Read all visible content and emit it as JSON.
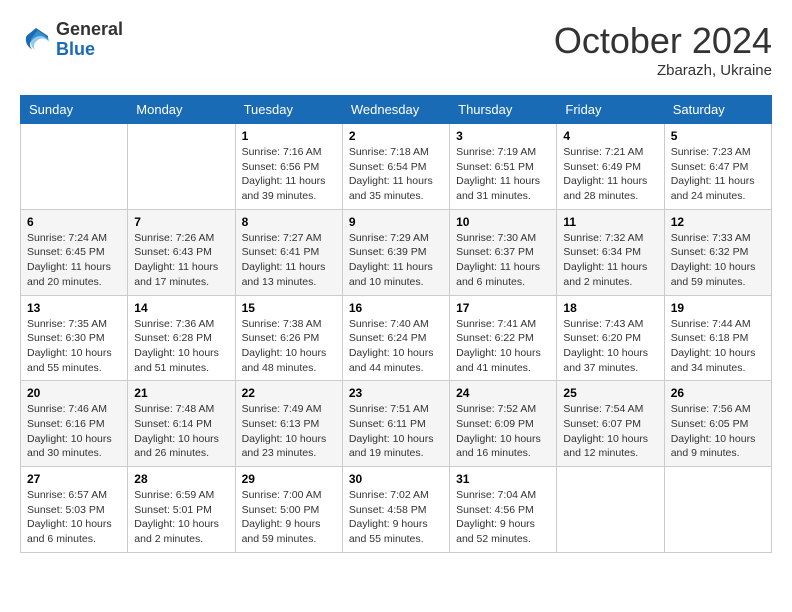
{
  "logo": {
    "general": "General",
    "blue": "Blue"
  },
  "header": {
    "month": "October 2024",
    "location": "Zbarazh, Ukraine"
  },
  "days_of_week": [
    "Sunday",
    "Monday",
    "Tuesday",
    "Wednesday",
    "Thursday",
    "Friday",
    "Saturday"
  ],
  "weeks": [
    [
      {
        "day": null,
        "sunrise": null,
        "sunset": null,
        "daylight": null
      },
      {
        "day": null,
        "sunrise": null,
        "sunset": null,
        "daylight": null
      },
      {
        "day": "1",
        "sunrise": "Sunrise: 7:16 AM",
        "sunset": "Sunset: 6:56 PM",
        "daylight": "Daylight: 11 hours and 39 minutes."
      },
      {
        "day": "2",
        "sunrise": "Sunrise: 7:18 AM",
        "sunset": "Sunset: 6:54 PM",
        "daylight": "Daylight: 11 hours and 35 minutes."
      },
      {
        "day": "3",
        "sunrise": "Sunrise: 7:19 AM",
        "sunset": "Sunset: 6:51 PM",
        "daylight": "Daylight: 11 hours and 31 minutes."
      },
      {
        "day": "4",
        "sunrise": "Sunrise: 7:21 AM",
        "sunset": "Sunset: 6:49 PM",
        "daylight": "Daylight: 11 hours and 28 minutes."
      },
      {
        "day": "5",
        "sunrise": "Sunrise: 7:23 AM",
        "sunset": "Sunset: 6:47 PM",
        "daylight": "Daylight: 11 hours and 24 minutes."
      }
    ],
    [
      {
        "day": "6",
        "sunrise": "Sunrise: 7:24 AM",
        "sunset": "Sunset: 6:45 PM",
        "daylight": "Daylight: 11 hours and 20 minutes."
      },
      {
        "day": "7",
        "sunrise": "Sunrise: 7:26 AM",
        "sunset": "Sunset: 6:43 PM",
        "daylight": "Daylight: 11 hours and 17 minutes."
      },
      {
        "day": "8",
        "sunrise": "Sunrise: 7:27 AM",
        "sunset": "Sunset: 6:41 PM",
        "daylight": "Daylight: 11 hours and 13 minutes."
      },
      {
        "day": "9",
        "sunrise": "Sunrise: 7:29 AM",
        "sunset": "Sunset: 6:39 PM",
        "daylight": "Daylight: 11 hours and 10 minutes."
      },
      {
        "day": "10",
        "sunrise": "Sunrise: 7:30 AM",
        "sunset": "Sunset: 6:37 PM",
        "daylight": "Daylight: 11 hours and 6 minutes."
      },
      {
        "day": "11",
        "sunrise": "Sunrise: 7:32 AM",
        "sunset": "Sunset: 6:34 PM",
        "daylight": "Daylight: 11 hours and 2 minutes."
      },
      {
        "day": "12",
        "sunrise": "Sunrise: 7:33 AM",
        "sunset": "Sunset: 6:32 PM",
        "daylight": "Daylight: 10 hours and 59 minutes."
      }
    ],
    [
      {
        "day": "13",
        "sunrise": "Sunrise: 7:35 AM",
        "sunset": "Sunset: 6:30 PM",
        "daylight": "Daylight: 10 hours and 55 minutes."
      },
      {
        "day": "14",
        "sunrise": "Sunrise: 7:36 AM",
        "sunset": "Sunset: 6:28 PM",
        "daylight": "Daylight: 10 hours and 51 minutes."
      },
      {
        "day": "15",
        "sunrise": "Sunrise: 7:38 AM",
        "sunset": "Sunset: 6:26 PM",
        "daylight": "Daylight: 10 hours and 48 minutes."
      },
      {
        "day": "16",
        "sunrise": "Sunrise: 7:40 AM",
        "sunset": "Sunset: 6:24 PM",
        "daylight": "Daylight: 10 hours and 44 minutes."
      },
      {
        "day": "17",
        "sunrise": "Sunrise: 7:41 AM",
        "sunset": "Sunset: 6:22 PM",
        "daylight": "Daylight: 10 hours and 41 minutes."
      },
      {
        "day": "18",
        "sunrise": "Sunrise: 7:43 AM",
        "sunset": "Sunset: 6:20 PM",
        "daylight": "Daylight: 10 hours and 37 minutes."
      },
      {
        "day": "19",
        "sunrise": "Sunrise: 7:44 AM",
        "sunset": "Sunset: 6:18 PM",
        "daylight": "Daylight: 10 hours and 34 minutes."
      }
    ],
    [
      {
        "day": "20",
        "sunrise": "Sunrise: 7:46 AM",
        "sunset": "Sunset: 6:16 PM",
        "daylight": "Daylight: 10 hours and 30 minutes."
      },
      {
        "day": "21",
        "sunrise": "Sunrise: 7:48 AM",
        "sunset": "Sunset: 6:14 PM",
        "daylight": "Daylight: 10 hours and 26 minutes."
      },
      {
        "day": "22",
        "sunrise": "Sunrise: 7:49 AM",
        "sunset": "Sunset: 6:13 PM",
        "daylight": "Daylight: 10 hours and 23 minutes."
      },
      {
        "day": "23",
        "sunrise": "Sunrise: 7:51 AM",
        "sunset": "Sunset: 6:11 PM",
        "daylight": "Daylight: 10 hours and 19 minutes."
      },
      {
        "day": "24",
        "sunrise": "Sunrise: 7:52 AM",
        "sunset": "Sunset: 6:09 PM",
        "daylight": "Daylight: 10 hours and 16 minutes."
      },
      {
        "day": "25",
        "sunrise": "Sunrise: 7:54 AM",
        "sunset": "Sunset: 6:07 PM",
        "daylight": "Daylight: 10 hours and 12 minutes."
      },
      {
        "day": "26",
        "sunrise": "Sunrise: 7:56 AM",
        "sunset": "Sunset: 6:05 PM",
        "daylight": "Daylight: 10 hours and 9 minutes."
      }
    ],
    [
      {
        "day": "27",
        "sunrise": "Sunrise: 6:57 AM",
        "sunset": "Sunset: 5:03 PM",
        "daylight": "Daylight: 10 hours and 6 minutes."
      },
      {
        "day": "28",
        "sunrise": "Sunrise: 6:59 AM",
        "sunset": "Sunset: 5:01 PM",
        "daylight": "Daylight: 10 hours and 2 minutes."
      },
      {
        "day": "29",
        "sunrise": "Sunrise: 7:00 AM",
        "sunset": "Sunset: 5:00 PM",
        "daylight": "Daylight: 9 hours and 59 minutes."
      },
      {
        "day": "30",
        "sunrise": "Sunrise: 7:02 AM",
        "sunset": "Sunset: 4:58 PM",
        "daylight": "Daylight: 9 hours and 55 minutes."
      },
      {
        "day": "31",
        "sunrise": "Sunrise: 7:04 AM",
        "sunset": "Sunset: 4:56 PM",
        "daylight": "Daylight: 9 hours and 52 minutes."
      },
      {
        "day": null,
        "sunrise": null,
        "sunset": null,
        "daylight": null
      },
      {
        "day": null,
        "sunrise": null,
        "sunset": null,
        "daylight": null
      }
    ]
  ]
}
